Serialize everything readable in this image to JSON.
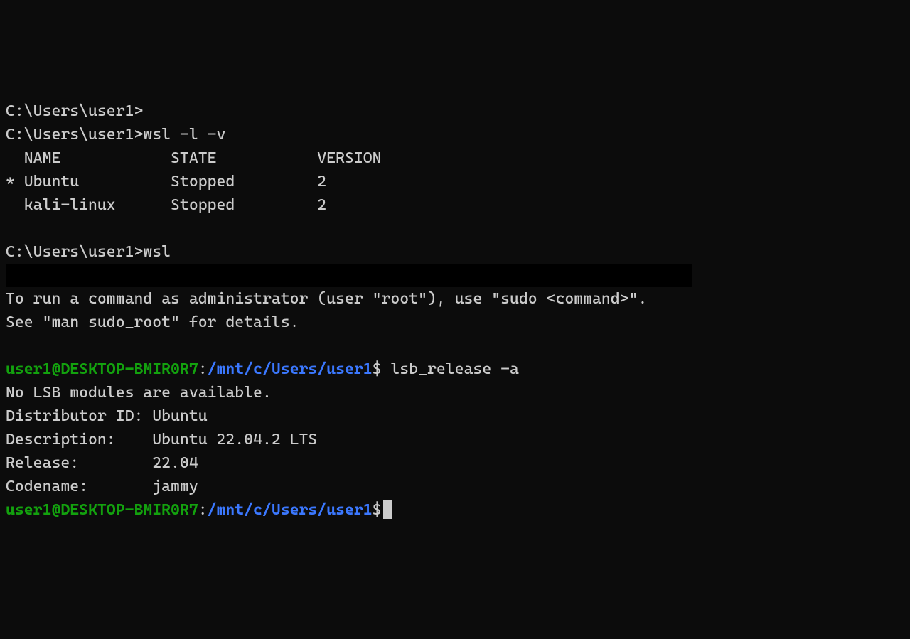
{
  "prompt_windows": "C:\\Users\\user1>",
  "cmd_wsl_list": "wsl -l -v",
  "table": {
    "header": "  NAME            STATE           VERSION",
    "row1": "* Ubuntu          Stopped         2",
    "row2": "  kali-linux      Stopped         2"
  },
  "cmd_wsl": "wsl",
  "sudo_hint_1": "To run a command as administrator (user \"root\"), use \"sudo <command>\".",
  "sudo_hint_2": "See \"man sudo_root\" for details.",
  "linux_prompt": {
    "user_host": "user1@DESKTOP-BMIR0R7",
    "colon": ":",
    "path": "/mnt/c/Users/user1",
    "dollar": "$"
  },
  "cmd_lsb": " lsb_release -a",
  "lsb_output": {
    "line1": "No LSB modules are available.",
    "line2": "Distributor ID: Ubuntu",
    "line3": "Description:    Ubuntu 22.04.2 LTS",
    "line4": "Release:        22.04",
    "line5": "Codename:       jammy"
  }
}
